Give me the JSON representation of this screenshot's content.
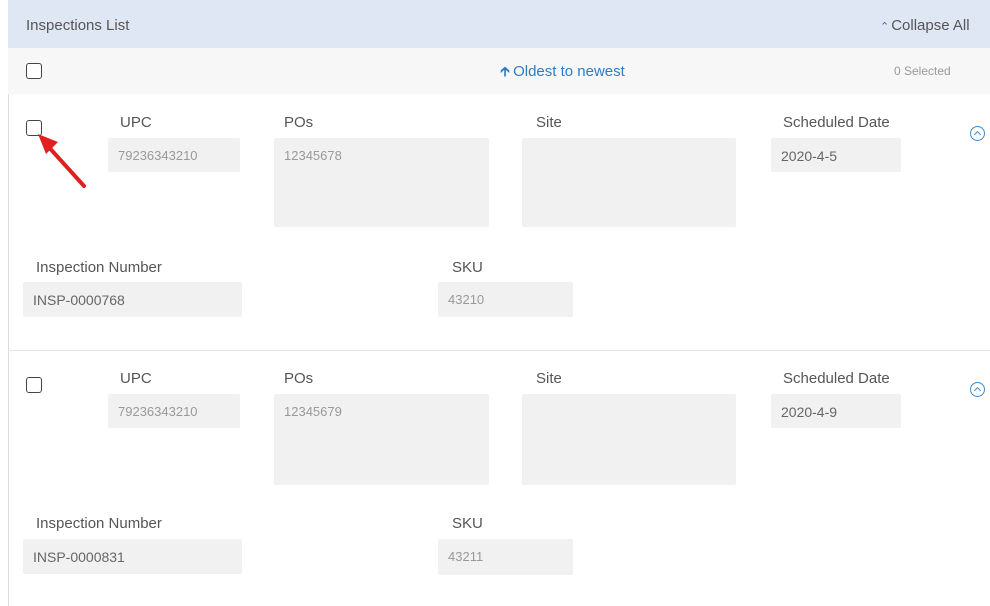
{
  "header": {
    "title": "Inspections List",
    "collapse_icon": "double-chevron-up-icon",
    "collapse_label": "Collapse All"
  },
  "sortbar": {
    "sort_label": "Oldest to newest",
    "sort_icon": "arrow-up-icon",
    "selected_count": "0 Selected"
  },
  "labels": {
    "upc": "UPC",
    "pos": "POs",
    "site": "Site",
    "scheduled_date": "Scheduled Date",
    "inspection_number": "Inspection Number",
    "sku": "SKU"
  },
  "inspections": [
    {
      "upc": "79236343210",
      "pos": "12345678",
      "site": "",
      "scheduled_date": "2020-4-5",
      "inspection_number": "INSP-0000768",
      "sku": "43210"
    },
    {
      "upc": "79236343210",
      "pos": "12345679",
      "site": "",
      "scheduled_date": "2020-4-9",
      "inspection_number": "INSP-0000831",
      "sku": "43211"
    }
  ],
  "colors": {
    "header_bg": "#dfe7f5",
    "link_blue": "#2e7cc2",
    "annotation_red": "#e02020"
  }
}
